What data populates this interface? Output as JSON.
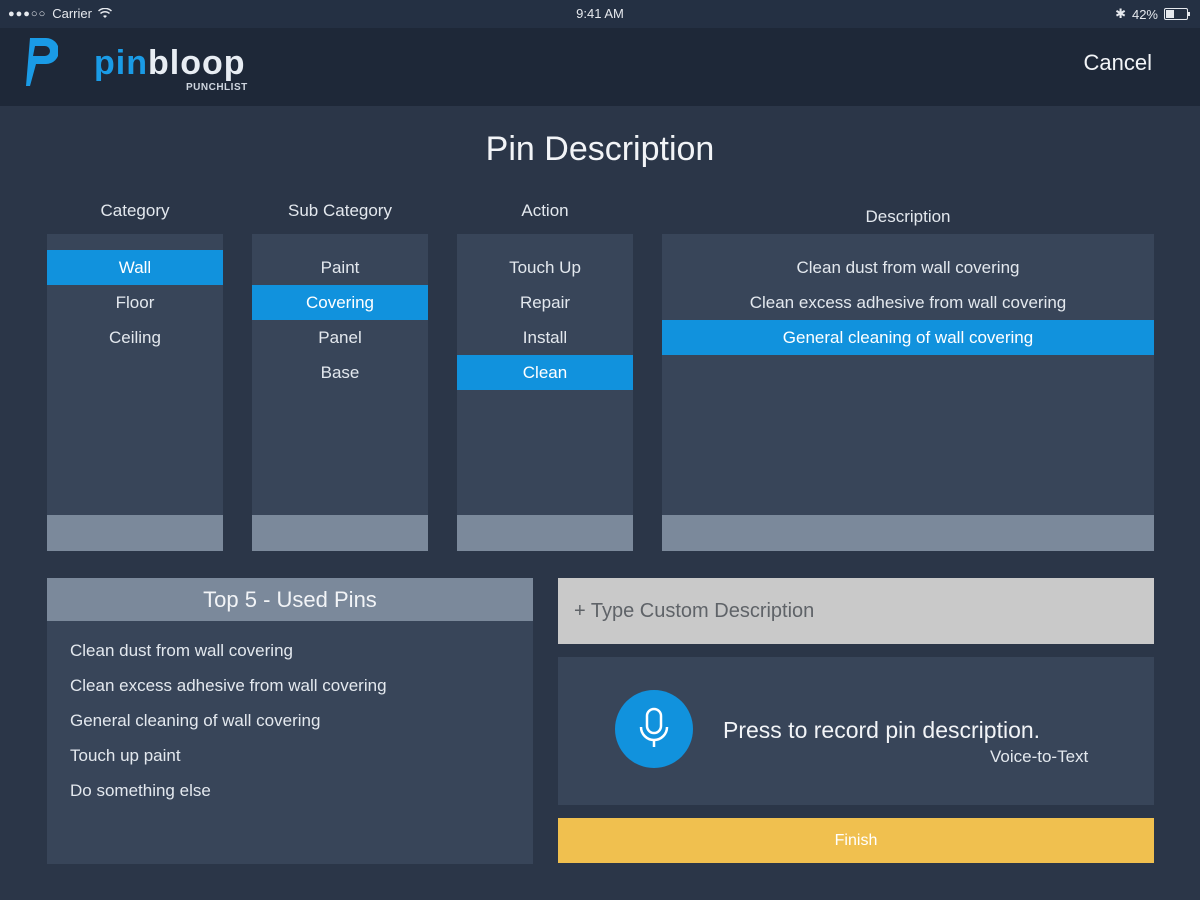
{
  "status_bar": {
    "carrier": "Carrier",
    "time": "9:41 AM",
    "battery": "42%",
    "battery_level": 0.42
  },
  "header": {
    "logo_pin": "pin",
    "logo_bloop": "bloop",
    "logo_sub": "PUNCHLIST",
    "cancel_label": "Cancel"
  },
  "page": {
    "title": "Pin Description"
  },
  "columns": {
    "category": {
      "label": "Category",
      "items": [
        "Wall",
        "Floor",
        "Ceiling"
      ],
      "selected": 0
    },
    "sub_category": {
      "label": "Sub Category",
      "items": [
        "Paint",
        "Covering",
        "Panel",
        "Base"
      ],
      "selected": 1
    },
    "action": {
      "label": "Action",
      "items": [
        "Touch Up",
        "Repair",
        "Install",
        "Clean"
      ],
      "selected": 3
    },
    "description": {
      "label": "Description",
      "items": [
        "Clean dust from wall covering",
        "Clean excess adhesive from wall covering",
        "General cleaning of wall covering"
      ],
      "selected": 2
    }
  },
  "top5": {
    "title": "Top 5 - Used Pins",
    "items": [
      "Clean dust from wall covering",
      "Clean excess adhesive from wall covering",
      "General cleaning of wall covering",
      "Touch up paint",
      "Do something else"
    ]
  },
  "custom": {
    "placeholder": "+ Type Custom Description"
  },
  "voice": {
    "prompt": "Press to record pin description.",
    "sub": "Voice-to-Text"
  },
  "finish": {
    "label": "Finish"
  },
  "colors": {
    "accent": "#1192dd",
    "finish": "#f0c04f",
    "panel": "#384559",
    "panel_footer": "#7b899b"
  }
}
